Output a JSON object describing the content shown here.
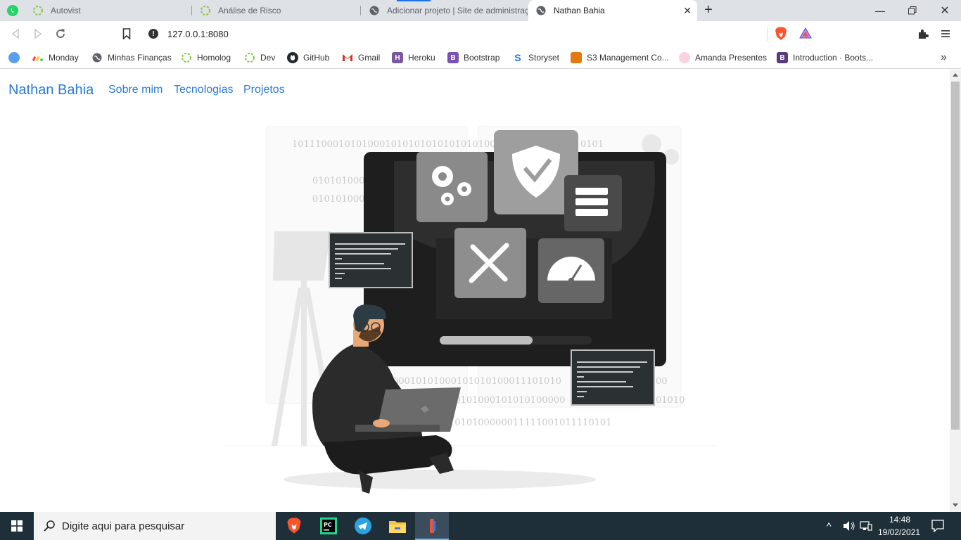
{
  "browser": {
    "tabs": [
      {
        "title": "",
        "icon": "whatsapp-icon"
      },
      {
        "title": "Autovist",
        "icon": "spinner-icon"
      },
      {
        "title": "Análise de Risco",
        "icon": "spinner-icon"
      },
      {
        "title": "Adicionar projeto | Site de administraç",
        "icon": "globe-icon"
      },
      {
        "title": "Nathan Bahia",
        "icon": "globe-icon",
        "active": true
      }
    ],
    "new_tab": "+",
    "url": "127.0.0.1:8080",
    "bookmarks": [
      {
        "label": "Monday",
        "icon": "monday-icon",
        "color": "#ff3d57"
      },
      {
        "label": "Minhas Finanças",
        "icon": "globe-icon",
        "color": "#5f6368"
      },
      {
        "label": "Homolog",
        "icon": "spinner-icon",
        "color": "#8bc34a"
      },
      {
        "label": "Dev",
        "icon": "spinner-icon",
        "color": "#8bc34a"
      },
      {
        "label": "GitHub",
        "icon": "github-icon",
        "color": "#24292e"
      },
      {
        "label": "Gmail",
        "icon": "gmail-icon",
        "color": "#d93025"
      },
      {
        "label": "Heroku",
        "icon": "heroku-icon",
        "color": "#79589f"
      },
      {
        "label": "Bootstrap",
        "icon": "bootstrap-icon",
        "color": "#7952b3"
      },
      {
        "label": "Storyset",
        "icon": "storyset-icon",
        "color": "#1a73e8"
      },
      {
        "label": "S3 Management Co...",
        "icon": "aws-icon",
        "color": "#e47911"
      },
      {
        "label": "Amanda Presentes",
        "icon": "flower-icon",
        "color": "#f48fb1"
      },
      {
        "label": "Introduction · Boots...",
        "icon": "bootstrap-icon",
        "color": "#563d7c"
      }
    ],
    "more_bookmarks": "»"
  },
  "page": {
    "brand": "Nathan Bahia",
    "nav": [
      "Sobre mim",
      "Tecnologias",
      "Projetos"
    ],
    "hero_image": "developer-illustration",
    "binary_rows": [
      "1011100010101000101010101010101010000",
      "0101010000",
      "0101010000",
      "0101",
      "00010101000101010100011101010",
      "10101000101010100000",
      "01010",
      "1010100000011111001011110101",
      "00",
      "101"
    ]
  },
  "taskbar": {
    "search_placeholder": "Digite aqui para pesquisar",
    "apps": [
      "brave-icon",
      "pycharm-icon",
      "telegram-icon",
      "file-explorer-icon",
      "git-icon"
    ],
    "time": "14:48",
    "date": "19/02/2021"
  },
  "colors": {
    "accent": "#2a7bd6",
    "tabbar": "#dee1e6",
    "taskbar": "#1f2f3a"
  }
}
